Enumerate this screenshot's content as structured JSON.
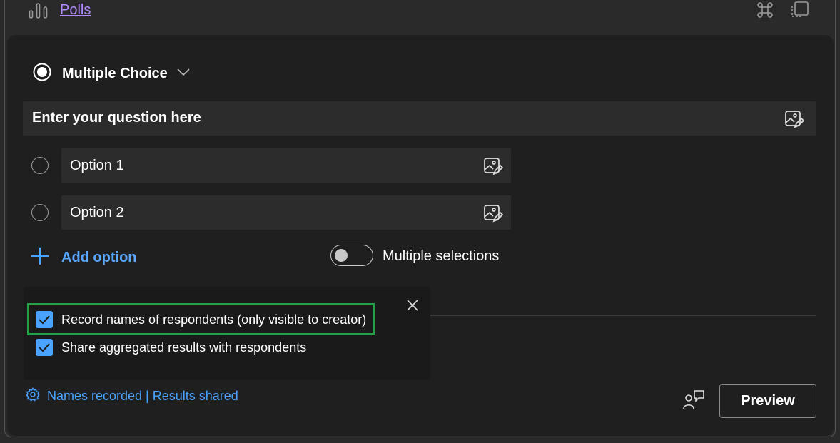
{
  "header": {
    "title": "Polls",
    "icons": {
      "poll": "bar-chart-icon",
      "apps": "command-icon",
      "popout": "popout-icon"
    }
  },
  "question_type": {
    "label": "Multiple Choice",
    "icon": "radio-selected-icon"
  },
  "question": {
    "placeholder": "Enter your question here",
    "icon": "image-edit-icon"
  },
  "options": [
    {
      "label": "Option 1",
      "icon": "image-edit-icon"
    },
    {
      "label": "Option 2",
      "icon": "image-edit-icon"
    }
  ],
  "add_option": {
    "label": "Add option",
    "icon": "plus-icon"
  },
  "multiple_selections": {
    "label": "Multiple selections",
    "on": false
  },
  "settings_popup": {
    "items": [
      {
        "label": "Record names of respondents (only visible to creator)",
        "checked": true,
        "highlighted": true
      },
      {
        "label": "Share aggregated results with respondents",
        "checked": true,
        "highlighted": false
      }
    ],
    "close_icon": "close-icon"
  },
  "footer": {
    "settings_summary": "Names recorded | Results shared",
    "settings_icon": "gear-icon",
    "feedback_icon": "feedback-icon",
    "preview_label": "Preview"
  },
  "colors": {
    "accent": "#4aa3ff",
    "link_purple": "#b18cff",
    "highlight_green": "#24a047",
    "card_bg": "#1f1f1f"
  }
}
